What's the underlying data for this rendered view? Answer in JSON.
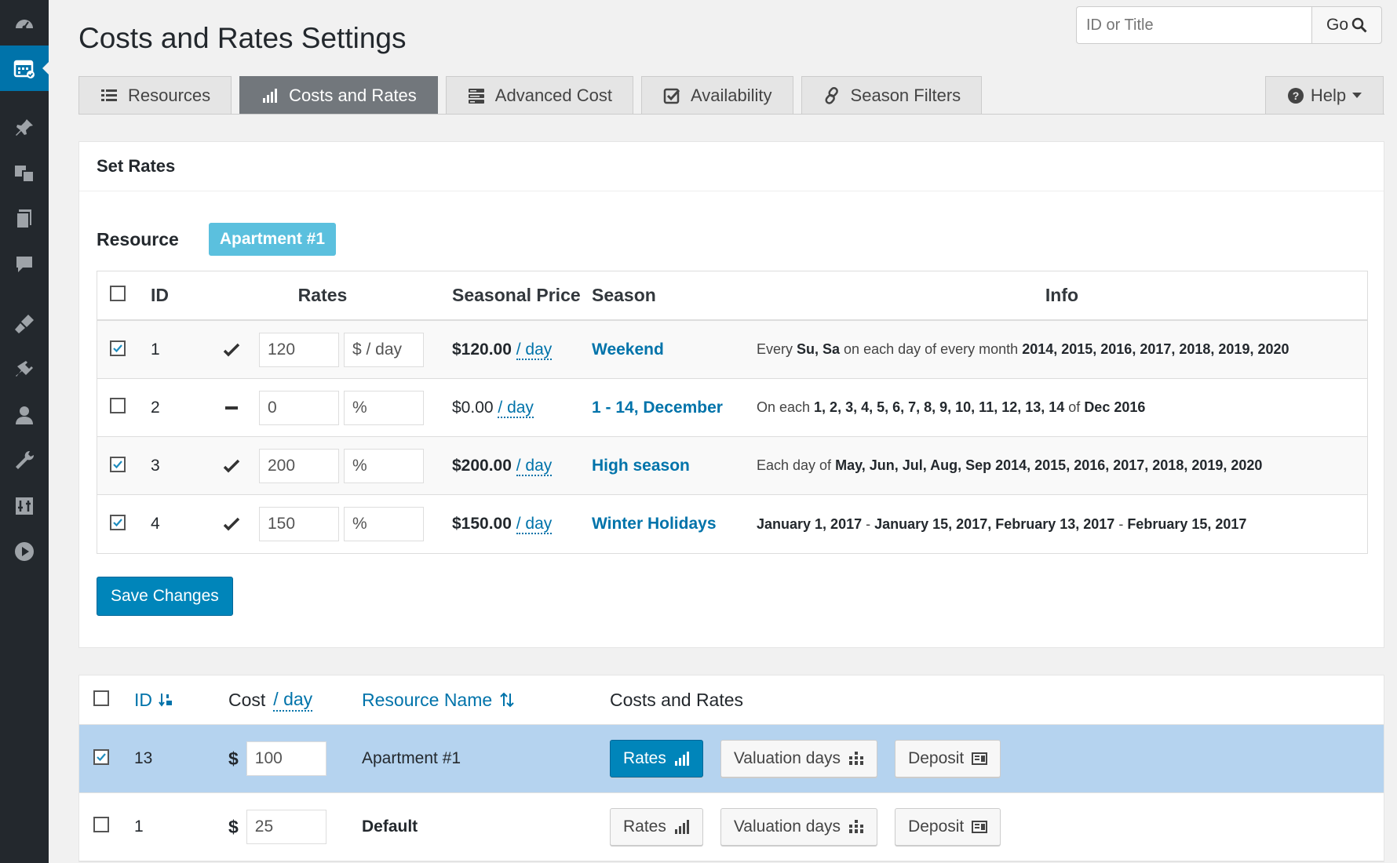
{
  "sidebar": {
    "items": [
      {
        "icon": "dashboard-icon"
      },
      {
        "icon": "calendar-icon",
        "active": true
      },
      {
        "icon": "pin-icon"
      },
      {
        "icon": "media-icon"
      },
      {
        "icon": "pages-icon"
      },
      {
        "icon": "comments-icon"
      },
      {
        "icon": "appearance-icon"
      },
      {
        "icon": "plugins-icon"
      },
      {
        "icon": "users-icon"
      },
      {
        "icon": "tools-icon"
      },
      {
        "icon": "settings-icon"
      },
      {
        "icon": "play-icon"
      }
    ]
  },
  "page": {
    "title": "Costs and Rates Settings"
  },
  "search": {
    "placeholder": "ID or Title",
    "go_label": "Go"
  },
  "tabs": [
    {
      "label": "Resources",
      "active": false
    },
    {
      "label": "Costs and Rates",
      "active": true
    },
    {
      "label": "Advanced Cost",
      "active": false
    },
    {
      "label": "Availability",
      "active": false
    },
    {
      "label": "Season Filters",
      "active": false
    }
  ],
  "help": {
    "label": "Help"
  },
  "set_rates": {
    "title": "Set Rates",
    "resource_label": "Resource",
    "resource_name": "Apartment #1",
    "headers": {
      "id": "ID",
      "rates": "Rates",
      "seasonal_price": "Seasonal Price",
      "season": "Season",
      "info": "Info"
    },
    "rows": [
      {
        "checked": true,
        "id": "1",
        "status": "check",
        "value": "120",
        "unit": "$ / day",
        "price": "$120.00",
        "per": "/ day",
        "price_bold": true,
        "season": "Weekend",
        "info": [
          [
            "Every ",
            false
          ],
          [
            "Su, Sa",
            true
          ],
          [
            " on each day of every month ",
            false
          ],
          [
            "2014, 2015, 2016, 2017, 2018, 2019, 2020",
            true
          ]
        ]
      },
      {
        "checked": false,
        "id": "2",
        "status": "dash",
        "value": "0",
        "unit": "%",
        "price": "$0.00",
        "per": "/ day",
        "price_bold": false,
        "season": "1 - 14, December",
        "info": [
          [
            "On each ",
            false
          ],
          [
            "1, 2, 3, 4, 5, 6, 7, 8, 9, 10, 11, 12, 13, 14",
            true
          ],
          [
            " of ",
            false
          ],
          [
            "Dec 2016",
            true
          ]
        ]
      },
      {
        "checked": true,
        "id": "3",
        "status": "check",
        "value": "200",
        "unit": "%",
        "price": "$200.00",
        "per": "/ day",
        "price_bold": true,
        "season": "High season",
        "info": [
          [
            "Each day of ",
            false
          ],
          [
            "May, Jun, Jul, Aug, Sep 2014, 2015, 2016, 2017, 2018, 2019, 2020",
            true
          ]
        ]
      },
      {
        "checked": true,
        "id": "4",
        "status": "check",
        "value": "150",
        "unit": "%",
        "price": "$150.00",
        "per": "/ day",
        "price_bold": true,
        "season": "Winter Holidays",
        "info": [
          [
            "January 1, 2017",
            true
          ],
          [
            " - ",
            false
          ],
          [
            "January 15, 2017, February 13, 2017",
            true
          ],
          [
            " - ",
            false
          ],
          [
            "February 15, 2017",
            true
          ]
        ]
      }
    ],
    "save_label": "Save Changes"
  },
  "resources_table": {
    "headers": {
      "id": "ID",
      "cost": "Cost",
      "per": "/ day",
      "name": "Resource Name",
      "actions": "Costs and Rates"
    },
    "rows": [
      {
        "checked": true,
        "selected": true,
        "id": "13",
        "currency": "$",
        "cost": "100",
        "name": "Apartment #1",
        "name_bold": false
      },
      {
        "checked": false,
        "selected": false,
        "id": "1",
        "currency": "$",
        "cost": "25",
        "name": "Default",
        "name_bold": true
      }
    ],
    "buttons": {
      "rates": "Rates",
      "valuation": "Valuation days",
      "deposit": "Deposit"
    }
  }
}
